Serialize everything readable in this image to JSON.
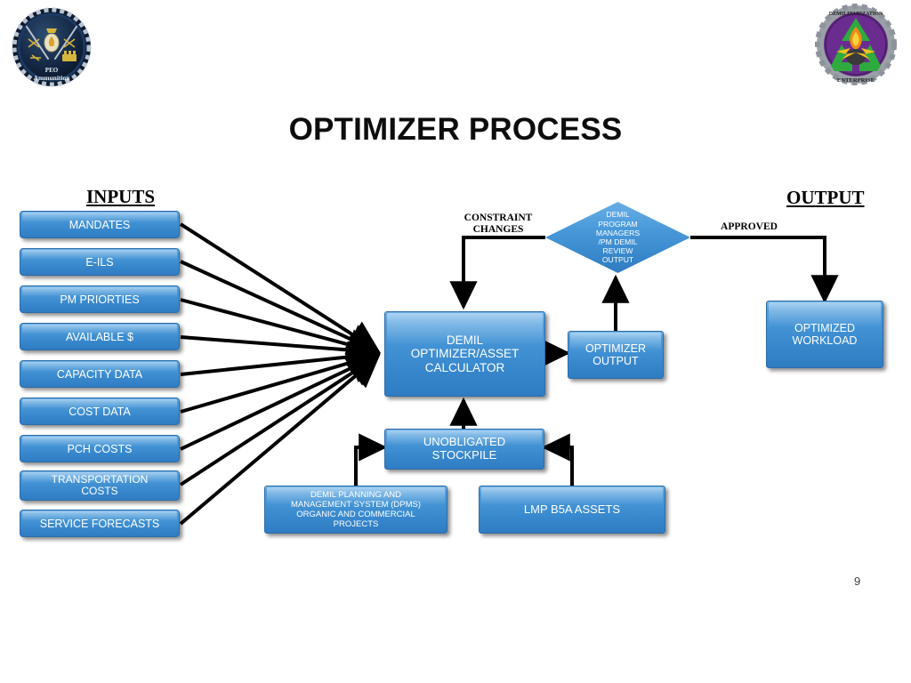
{
  "slide": {
    "title": "OPTIMIZER PROCESS",
    "page_number": "9",
    "background": "#ffffff",
    "box_accent": "#3f8fd2"
  },
  "logos": {
    "left": {
      "name": "peo-ammunition-seal",
      "text_top": "PEO",
      "text_bottom": "Ammunition"
    },
    "right": {
      "name": "demilitarization-enterprise-seal",
      "text_top": "DEMILITARIZATION",
      "text_bottom": "ENTERPRISE"
    }
  },
  "headers": {
    "inputs": "INPUTS",
    "output": "OUTPUT"
  },
  "inputs": [
    {
      "label": "MANDATES"
    },
    {
      "label": "E-ILS"
    },
    {
      "label": "PM PRIORTIES"
    },
    {
      "label": "AVAILABLE $"
    },
    {
      "label": "CAPACITY DATA"
    },
    {
      "label": "COST DATA"
    },
    {
      "label": "PCH COSTS"
    },
    {
      "label": "TRANSPORTATION\nCOSTS"
    },
    {
      "label": "SERVICE FORECASTS"
    }
  ],
  "nodes": {
    "calculator": "DEMIL\nOPTIMIZER/ASSET\nCALCULATOR",
    "optimizer_output": "OPTIMIZER\nOUTPUT",
    "review_diamond": "DEMIL\nPROGRAM\nMANAGERS\n/PM DEMIL\nREVIEW\nOUTPUT",
    "optimized_workload": "OPTIMIZED\nWORKLOAD",
    "unobligated_stockpile": "UNOBLIGATED\nSTOCKPILE",
    "dpms": "DEMIL PLANNING AND\nMANAGEMENT SYSTEM (DPMS)\nORGANIC  AND COMMERCIAL\nPROJECTS",
    "lmp": "LMP B5A ASSETS"
  },
  "edge_labels": {
    "constraint_changes": "CONSTRAINT\nCHANGES",
    "approved": "APPROVED"
  }
}
